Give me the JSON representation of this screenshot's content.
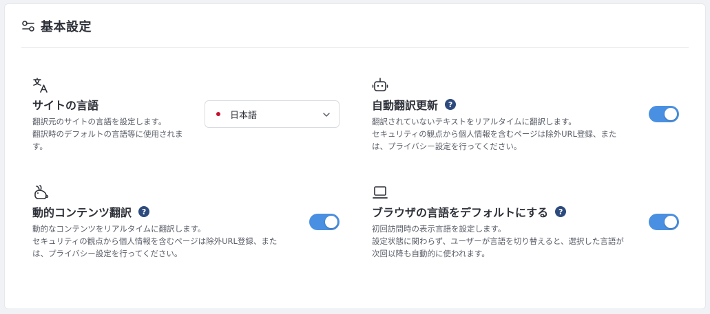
{
  "header": {
    "title": "基本設定",
    "icon": "settings-sliders-icon"
  },
  "settings": {
    "site_language": {
      "icon": "translate-icon",
      "title": "サイトの言語",
      "desc_lines": [
        "翻訳元のサイトの言語を設定します。",
        "翻訳時のデフォルトの言語等に使用されま",
        "す。"
      ],
      "selected": "日本語",
      "flag": "japan-flag-icon"
    },
    "auto_translate": {
      "icon": "robot-icon",
      "title": "自動翻訳更新",
      "help": "?",
      "desc_lines": [
        "翻訳されていないテキストをリアルタイムに翻訳します。",
        "セキュリティの観点から個人情報を含むページは除外URL登録、また",
        "は、プライバシー設定を行ってください。"
      ],
      "enabled": true
    },
    "dynamic_content": {
      "icon": "rabbit-icon",
      "title": "動的コンテンツ翻訳",
      "help": "?",
      "desc_lines": [
        "動的なコンテンツをリアルタイムに翻訳します。",
        "セキュリティの観点から個人情報を含むページは除外URL登録、また",
        "は、プライバシー設定を行ってください。"
      ],
      "enabled": true
    },
    "browser_default": {
      "icon": "laptop-icon",
      "title": "ブラウザの言語をデフォルトにする",
      "help": "?",
      "desc_lines": [
        "初回訪問時の表示言語を設定します。",
        "設定状態に関わらず、ユーザーが言語を切り替えると、選択した言語が",
        "次回以降も自動的に使われます。"
      ],
      "enabled": true
    }
  },
  "colors": {
    "toggle_on": "#4a90e2",
    "help_badge": "#2d4a7d"
  }
}
